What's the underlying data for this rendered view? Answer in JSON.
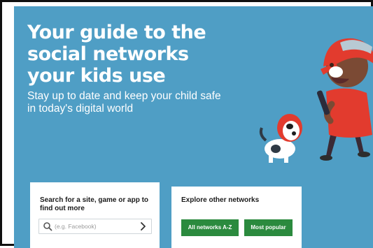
{
  "hero": {
    "headline": "Your guide to the\nsocial networks\nyour kids use",
    "subhead": "Stay up to date and keep your child safe in today's digital world"
  },
  "search": {
    "title": "Search for a site, game or app to find out more",
    "placeholder": "(e.g. Facebook)",
    "icon": "search-icon",
    "submit_icon": "chevron-right-icon"
  },
  "explore": {
    "title": "Explore other networks",
    "buttons": [
      "All networks A-Z",
      "Most popular"
    ]
  },
  "colors": {
    "hero_background": "#4f9ec5",
    "button_green": "#2b8a3e",
    "cap_red": "#e23b2e",
    "text_white": "#ffffff"
  }
}
